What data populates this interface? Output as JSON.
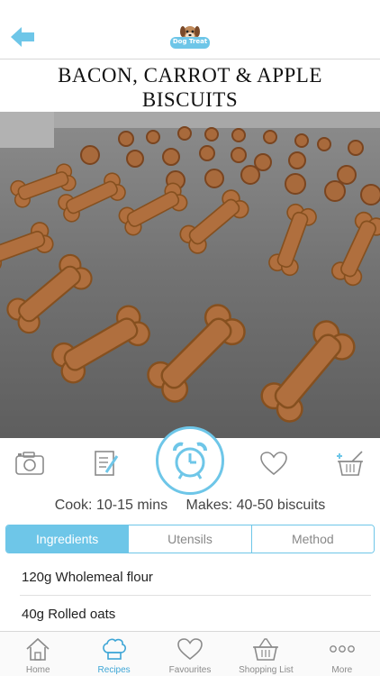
{
  "header": {
    "back_icon": "back-arrow-icon",
    "logo_text": "Dog Treat"
  },
  "recipe": {
    "title_line1": "BACON, CARROT & APPLE",
    "title_line2": "BISCUITS",
    "cook": "Cook: 10-15 mins",
    "makes": "Makes: 40-50 biscuits"
  },
  "actions": [
    {
      "name": "camera",
      "icon": "camera-icon"
    },
    {
      "name": "notes",
      "icon": "notepad-pen-icon"
    },
    {
      "name": "timer",
      "icon": "alarm-clock-icon"
    },
    {
      "name": "favourite",
      "icon": "heart-icon"
    },
    {
      "name": "add-to-basket",
      "icon": "basket-add-icon"
    }
  ],
  "tabs": [
    {
      "label": "Ingredients",
      "active": true
    },
    {
      "label": "Utensils",
      "active": false
    },
    {
      "label": "Method",
      "active": false
    }
  ],
  "ingredients": [
    "120g Wholemeal flour",
    "40g Rolled oats"
  ],
  "tabbar": [
    {
      "label": "Home",
      "icon": "home-icon",
      "active": false
    },
    {
      "label": "Recipes",
      "icon": "chef-hat-icon",
      "active": true
    },
    {
      "label": "Favourites",
      "icon": "heart-icon",
      "active": false
    },
    {
      "label": "Shopping List",
      "icon": "basket-icon",
      "active": false
    },
    {
      "label": "More",
      "icon": "more-dots-icon",
      "active": false
    }
  ],
  "colors": {
    "accent": "#6ec6e8",
    "active_label": "#3ea6d6",
    "icon_gray": "#8a8a8a"
  }
}
